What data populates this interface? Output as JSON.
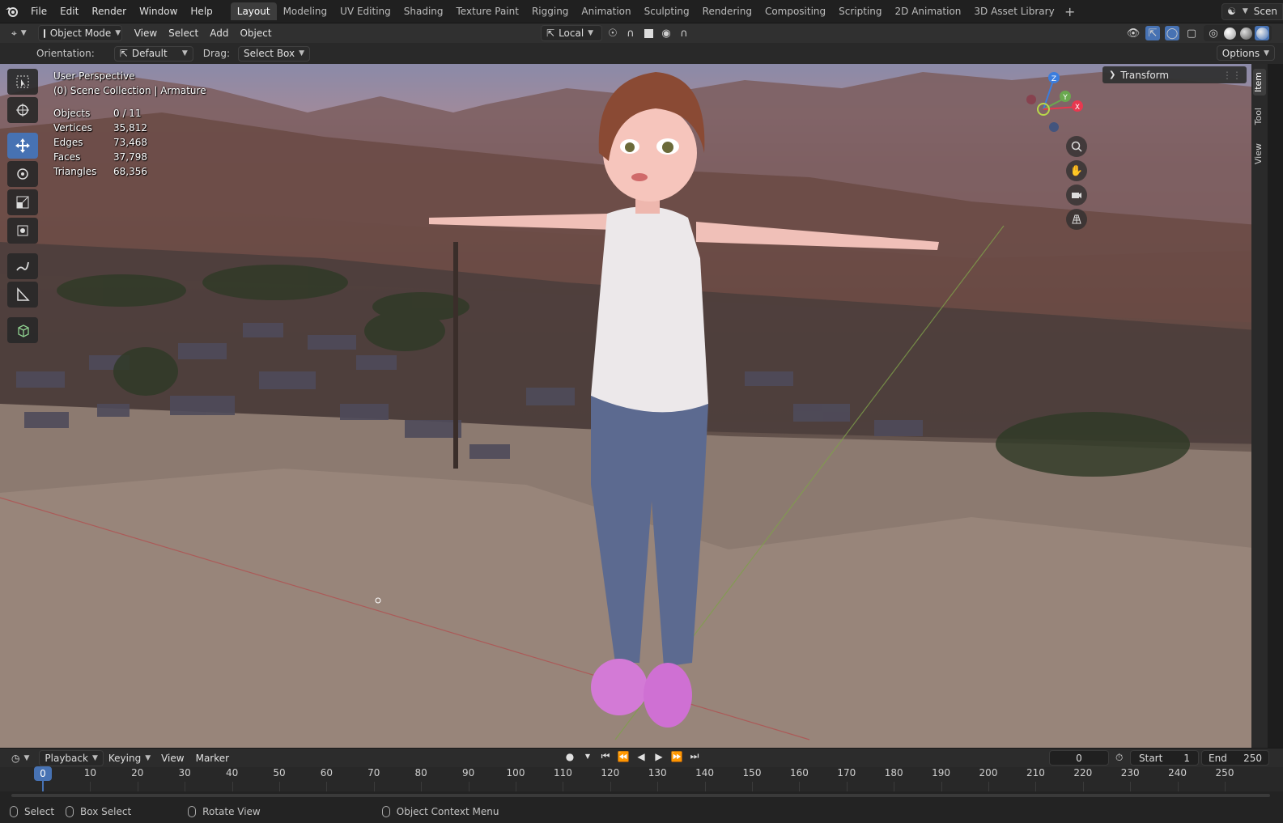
{
  "topbar": {
    "menus": [
      "File",
      "Edit",
      "Render",
      "Window",
      "Help"
    ],
    "workspaces": [
      "Layout",
      "Modeling",
      "UV Editing",
      "Shading",
      "Texture Paint",
      "Rigging",
      "Animation",
      "Sculpting",
      "Rendering",
      "Compositing",
      "Scripting",
      "2D Animation",
      "3D Asset Library"
    ],
    "active_workspace": "Layout",
    "add_tab": "+",
    "scene_label": "Scen"
  },
  "header": {
    "mode": "Object Mode",
    "menus": [
      "View",
      "Select",
      "Add",
      "Object"
    ],
    "transform_orientation": "Local"
  },
  "toolsettings": {
    "orientation_label": "Orientation:",
    "orientation_value": "Default",
    "drag_label": "Drag:",
    "drag_value": "Select Box",
    "options_label": "Options"
  },
  "viewport": {
    "perspective": "User Perspective",
    "collection": "(0) Scene Collection | Armature",
    "stats": [
      {
        "label": "Objects",
        "value": "0 / 11"
      },
      {
        "label": "Vertices",
        "value": "35,812"
      },
      {
        "label": "Edges",
        "value": "73,468"
      },
      {
        "label": "Faces",
        "value": "37,798"
      },
      {
        "label": "Triangles",
        "value": "68,356"
      }
    ],
    "gizmo": {
      "x": "X",
      "y": "Y",
      "z": "Z"
    }
  },
  "npanel": {
    "transform_label": "Transform",
    "tabs": [
      "Item",
      "Tool",
      "View"
    ],
    "active_tab": "Item"
  },
  "timeline": {
    "menus": [
      "Playback",
      "Keying",
      "View",
      "Marker"
    ],
    "current_frame": "0",
    "start_label": "Start",
    "start_value": "1",
    "end_label": "End",
    "end_value": "250",
    "ticks": [
      "0",
      "10",
      "20",
      "30",
      "40",
      "50",
      "60",
      "70",
      "80",
      "90",
      "100",
      "110",
      "120",
      "130",
      "140",
      "150",
      "160",
      "170",
      "180",
      "190",
      "200",
      "210",
      "220",
      "230",
      "240",
      "250"
    ],
    "playhead_label": "0"
  },
  "statusbar": {
    "select": "Select",
    "box_select": "Box Select",
    "rotate_view": "Rotate View",
    "context_menu": "Object Context Menu"
  },
  "colors": {
    "accent": "#4772b3",
    "x_axis": "#e8384f",
    "y_axis": "#6aa84f",
    "z_axis": "#3b7ddd"
  }
}
